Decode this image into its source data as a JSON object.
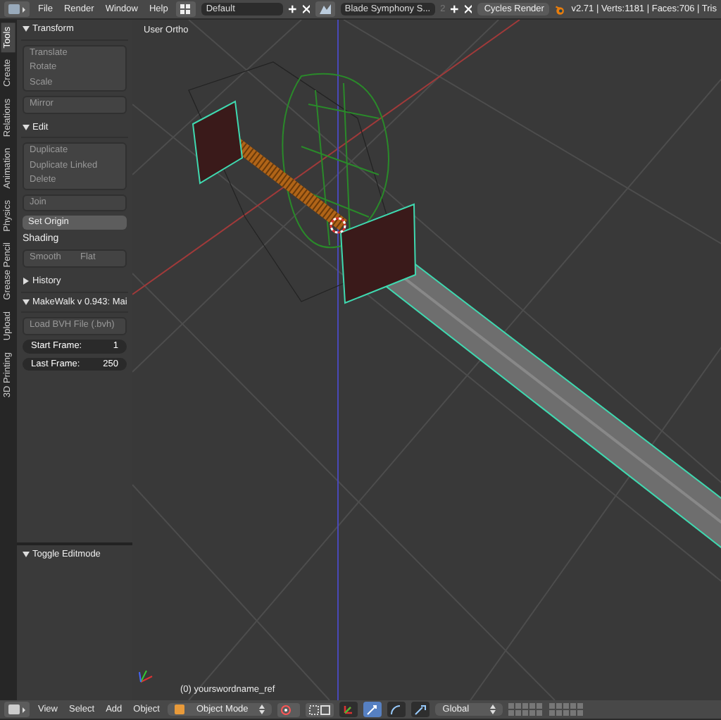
{
  "top_bar": {
    "menus": [
      "File",
      "Render",
      "Window",
      "Help"
    ],
    "layout": "Default",
    "scene": "Blade Symphony S...",
    "scene_users": "2",
    "engine": "Cycles Render",
    "stats": "v2.71 | Verts:1181 | Faces:706 | Tris"
  },
  "tool_tabs": [
    {
      "label": "Tools",
      "selected": true
    },
    {
      "label": "Create",
      "selected": false
    },
    {
      "label": "Relations",
      "selected": false
    },
    {
      "label": "Animation",
      "selected": false
    },
    {
      "label": "Physics",
      "selected": false
    },
    {
      "label": "Grease Pencil",
      "selected": false
    },
    {
      "label": "Upload",
      "selected": false
    },
    {
      "label": "3D Printing",
      "selected": false
    }
  ],
  "panels": [
    {
      "title": "Transform",
      "expanded": true,
      "items": [
        {
          "kind": "group",
          "buttons": [
            "Translate",
            "Rotate",
            "Scale"
          ]
        },
        {
          "kind": "group",
          "buttons": [
            "Mirror"
          ]
        }
      ]
    },
    {
      "title": "Edit",
      "expanded": true,
      "items": [
        {
          "kind": "group",
          "buttons": [
            "Duplicate",
            "Duplicate Linked",
            "Delete"
          ]
        },
        {
          "kind": "group",
          "buttons": [
            "Join"
          ]
        },
        {
          "kind": "dropdown",
          "label": "Set Origin"
        },
        {
          "kind": "label",
          "label": "Shading"
        },
        {
          "kind": "row",
          "buttons": [
            "Smooth",
            "Flat"
          ]
        }
      ]
    },
    {
      "title": "History",
      "expanded": false
    },
    {
      "title": "MakeWalk v 0.943: Mai",
      "expanded": true,
      "items": [
        {
          "kind": "group",
          "buttons": [
            "Load BVH File (.bvh)"
          ]
        },
        {
          "kind": "number",
          "label": "Start Frame:",
          "value": "1"
        },
        {
          "kind": "number",
          "label": "Last Frame:",
          "value": "250"
        }
      ]
    }
  ],
  "operator_panel": {
    "title": "Toggle Editmode",
    "expanded": true
  },
  "viewport": {
    "view_label": "User Ortho",
    "object_label": "(0) yourswordname_ref"
  },
  "bottom_bar": {
    "menus": [
      "View",
      "Select",
      "Add",
      "Object"
    ],
    "mode": "Object Mode",
    "manipulators": [
      {
        "on": false
      },
      {
        "on": true
      },
      {
        "on": false
      },
      {
        "on": false
      }
    ],
    "orientation": "Global"
  }
}
